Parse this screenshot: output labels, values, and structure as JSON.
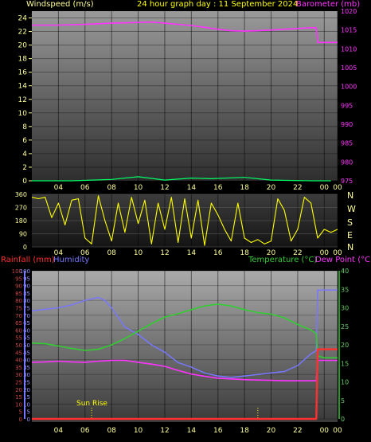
{
  "colors": {
    "windspeed": "#00ff66",
    "barometer": "#ff33ff",
    "direction": "#ffff00",
    "rainfall": "#ff3030",
    "humidity": "#7777ff",
    "temperature": "#33cc33",
    "dewpoint": "#ff33ff",
    "title": "#ffff00",
    "tick": "#ffff99",
    "rain_axis": "#cc4444",
    "hum_axis": "#9999ff",
    "temp_axis": "#66cc66"
  },
  "header": {
    "windspeed_label": "Windspeed (m/s)",
    "title": "24 hour graph day : 11 September 2024",
    "barometer_label": "Barometer (mb)"
  },
  "bottom_header": {
    "rainfall_label": "Rainfall (mm)",
    "humidity_label": "Humidity",
    "temperature_label": "Temperature (°C)",
    "dewpoint_label": "Dew Point (°C)"
  },
  "annotation": {
    "sunrise": "Sun Rise"
  },
  "compass": [
    "N",
    "W",
    "S",
    "E",
    "N"
  ],
  "chart_data": [
    {
      "type": "line",
      "x_ticks": [
        "04",
        "06",
        "08",
        "10",
        "12",
        "14",
        "16",
        "18",
        "20",
        "22",
        "00",
        "00"
      ],
      "left_axis": {
        "label": "Windspeed (m/s)",
        "ylim": [
          0,
          25
        ],
        "ticks": [
          0,
          2,
          4,
          6,
          8,
          10,
          12,
          14,
          16,
          18,
          20,
          22,
          24
        ]
      },
      "right_axis": {
        "label": "Barometer (mb)",
        "ylim": [
          975,
          1020
        ],
        "ticks": [
          975,
          980,
          985,
          990,
          995,
          1000,
          1005,
          1010,
          1015,
          1020
        ]
      },
      "grid": true,
      "series": [
        {
          "name": "Windspeed (m/s)",
          "axis": "left",
          "x": [
            2,
            5,
            8,
            10,
            12,
            14,
            15.5,
            18,
            20,
            23,
            24.5
          ],
          "y": [
            0,
            0,
            0.2,
            0.6,
            0.1,
            0.4,
            0.3,
            0.5,
            0.1,
            0,
            0
          ]
        },
        {
          "name": "Barometer (mb)",
          "axis": "right",
          "x": [
            2,
            4,
            6,
            8,
            10,
            11,
            12,
            14,
            16,
            17,
            18,
            19,
            20,
            21,
            22,
            23,
            23.4,
            23.5,
            24,
            25
          ],
          "y": [
            1016.3,
            1016.3,
            1016.5,
            1016.8,
            1017.0,
            1017.1,
            1016.8,
            1016.2,
            1015.2,
            1014.8,
            1014.7,
            1014.8,
            1015.0,
            1015.2,
            1015.4,
            1015.6,
            1015.6,
            1011.7,
            1011.7,
            1011.7
          ]
        }
      ]
    },
    {
      "type": "line",
      "x_ticks": [
        "04",
        "06",
        "08",
        "10",
        "12",
        "14",
        "16",
        "18",
        "20",
        "22",
        "00",
        "00"
      ],
      "y_axis": {
        "ylim": [
          0,
          360
        ],
        "ticks": [
          0,
          90,
          180,
          270,
          360
        ]
      },
      "series": [
        {
          "name": "Wind direction",
          "x": [
            2,
            2.5,
            3,
            3.5,
            4,
            4.5,
            5,
            5.5,
            6,
            6.5,
            7,
            7.5,
            8,
            8.5,
            9,
            9.5,
            10,
            10.5,
            11,
            11.5,
            12,
            12.5,
            13,
            13.5,
            14,
            14.5,
            15,
            15.5,
            16,
            16.5,
            17,
            17.5,
            18,
            18.5,
            19,
            19.5,
            20,
            20.5,
            21,
            21.5,
            22,
            22.5,
            23,
            23.5,
            24,
            24.5,
            25
          ],
          "y": [
            340,
            330,
            340,
            200,
            300,
            150,
            320,
            330,
            60,
            20,
            350,
            180,
            40,
            300,
            100,
            340,
            160,
            320,
            20,
            300,
            120,
            340,
            30,
            330,
            60,
            320,
            10,
            300,
            220,
            120,
            40,
            300,
            60,
            30,
            50,
            20,
            40,
            330,
            250,
            40,
            120,
            340,
            300,
            60,
            120,
            100,
            120
          ]
        }
      ]
    },
    {
      "type": "line",
      "x_ticks": [
        "04",
        "06",
        "08",
        "10",
        "12",
        "14",
        "16",
        "18",
        "20",
        "22",
        "00",
        "00"
      ],
      "left_axis": {
        "ylim": [
          0,
          100
        ],
        "ticks": [
          0,
          5,
          10,
          15,
          20,
          25,
          30,
          35,
          40,
          45,
          50,
          55,
          60,
          65,
          70,
          75,
          80,
          85,
          90,
          95,
          100
        ]
      },
      "right_axis": {
        "label": "Temperature (°C)",
        "ylim": [
          0,
          40
        ],
        "ticks": [
          0,
          5,
          10,
          15,
          20,
          25,
          30,
          35,
          40
        ]
      },
      "series": [
        {
          "name": "Humidity",
          "axis": "left",
          "x": [
            2,
            3,
            4,
            5,
            6,
            7,
            7.5,
            8,
            9,
            10,
            11,
            12,
            13,
            14,
            15,
            16,
            17,
            18,
            19,
            20,
            21,
            22,
            23,
            23.4,
            23.5,
            24,
            25
          ],
          "y": [
            73,
            74,
            75,
            77,
            80,
            82,
            80,
            75,
            62,
            57,
            50,
            45,
            38,
            35,
            31,
            29,
            28,
            29,
            30,
            31,
            32,
            36,
            44,
            46,
            87,
            87,
            87
          ]
        },
        {
          "name": "Temperature (°C)",
          "axis": "right",
          "x": [
            2,
            3,
            4,
            5,
            6,
            7,
            8,
            9,
            10,
            11,
            12,
            13,
            14,
            15,
            16,
            17,
            18,
            19,
            20,
            21,
            22,
            23,
            23.4,
            23.5,
            24,
            25
          ],
          "y": [
            20.5,
            20.3,
            19.7,
            19.0,
            18.5,
            18.8,
            20.0,
            21.7,
            23.7,
            25.7,
            27.5,
            28.4,
            29.5,
            30.5,
            31.0,
            30.5,
            29.5,
            28.7,
            28.3,
            27.3,
            25.5,
            24.0,
            23.0,
            17,
            16.5,
            16.5
          ]
        },
        {
          "name": "Dew Point (°C)",
          "axis": "right",
          "x": [
            2,
            3,
            4,
            5,
            6,
            7,
            8,
            9,
            10,
            11,
            12,
            13,
            14,
            15,
            16,
            17,
            18,
            19,
            20,
            21,
            22,
            23,
            23.4,
            23.5,
            24,
            25
          ],
          "y": [
            15.3,
            15.4,
            15.6,
            15.4,
            15.3,
            15.6,
            15.8,
            15.8,
            15.3,
            14.8,
            14.2,
            13.1,
            12.1,
            11.5,
            11.0,
            10.8,
            10.6,
            10.5,
            10.4,
            10.3,
            10.3,
            10.3,
            10.3,
            15.8,
            15.8,
            15.8
          ]
        },
        {
          "name": "Rainfall (mm)",
          "axis": "left",
          "x": [
            2,
            23.4,
            23.5,
            25
          ],
          "y": [
            0,
            0,
            47,
            47
          ]
        }
      ]
    }
  ]
}
